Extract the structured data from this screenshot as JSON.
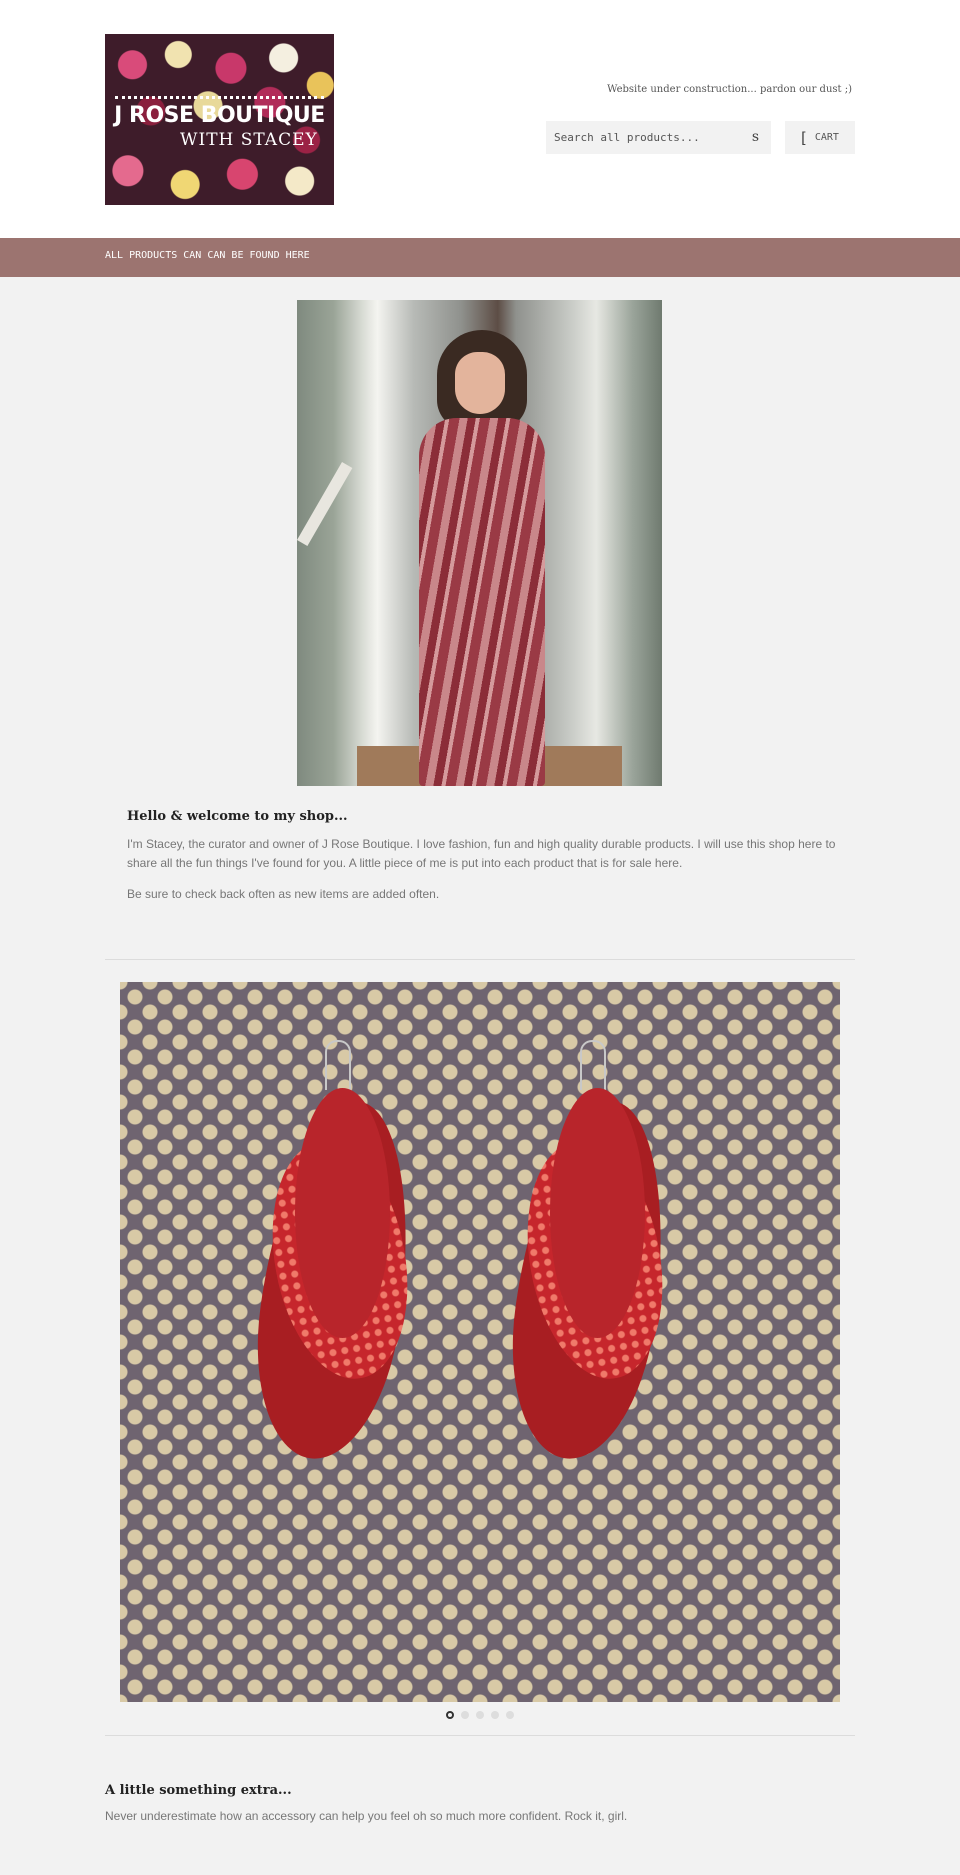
{
  "header": {
    "logo": {
      "title": "J ROSE BOUTIQUE",
      "subtitle": "WITH STACEY"
    },
    "tagline": "Website under construction... pardon our dust ;)",
    "search": {
      "placeholder": "Search all products...",
      "icon": "search-icon",
      "icon_glyph": "s"
    },
    "cart": {
      "icon": "cart-icon",
      "icon_glyph": "[",
      "label": "CART"
    }
  },
  "nav": {
    "items": [
      {
        "label": "ALL PRODUCTS CAN CAN BE FOUND HERE"
      }
    ]
  },
  "welcome": {
    "title": "Hello & welcome to my shop...",
    "paragraph1": "I'm Stacey, the curator and owner of J Rose Boutique. I love fashion, fun and high quality durable products.  I will use this shop here to share all the fun things I've found for you. A little piece of me is put into each product that is for sale here.",
    "paragraph2": "Be sure to check back often as new items are added often."
  },
  "slideshow": {
    "slide_count": 5,
    "active_slide": 1
  },
  "extra": {
    "title": "A little something extra...",
    "text": "Never underestimate how an accessory can help you feel oh so much more confident. Rock it, girl."
  },
  "colors": {
    "nav_background": "#9c7470",
    "page_background": "#f2f2f2",
    "header_background": "#ffffff"
  }
}
